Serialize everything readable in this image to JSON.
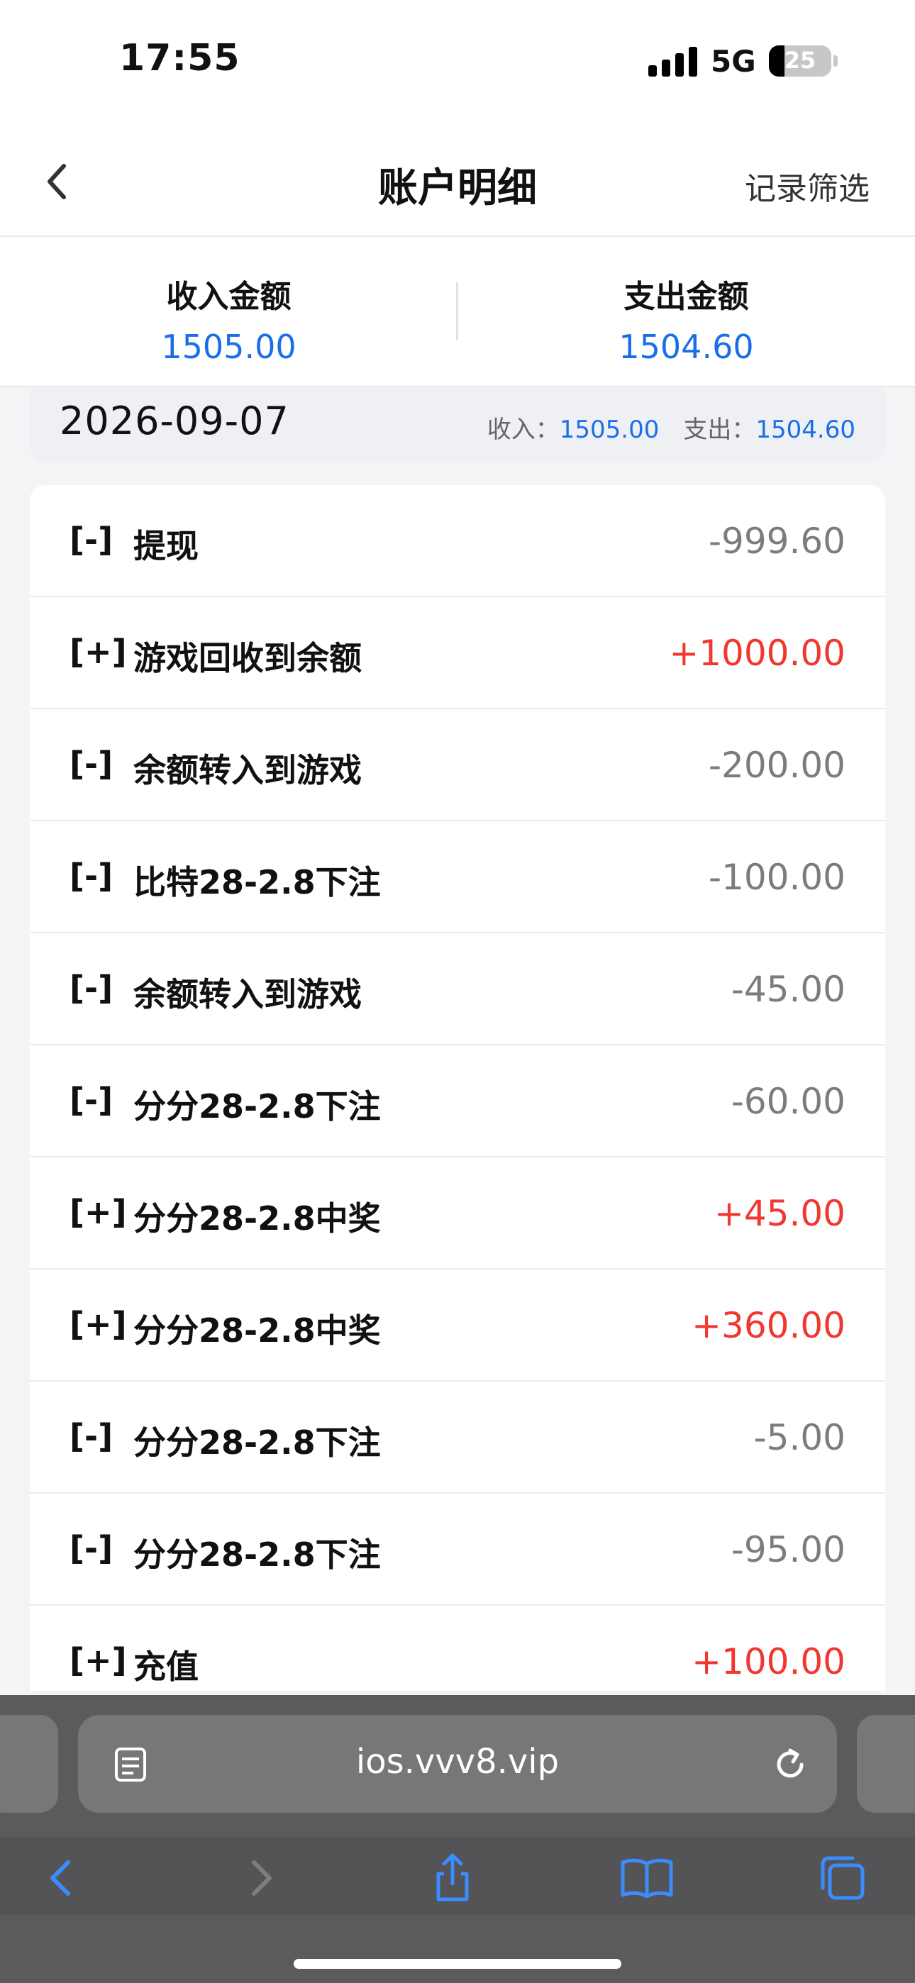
{
  "status": {
    "time": "17:55",
    "network": "5G",
    "battery": "25",
    "battery_level": 0.25
  },
  "nav": {
    "title": "账户明细",
    "filter": "记录筛选"
  },
  "summary": {
    "income_label": "收入金额",
    "income_value": "1505.00",
    "expense_label": "支出金额",
    "expense_value": "1504.60"
  },
  "date_group": {
    "date": "2026-09-07",
    "income_label": "收入：",
    "income": "1505.00",
    "expense_label": "支出：",
    "expense": "1504.60"
  },
  "transactions": [
    {
      "sign": "[-]",
      "desc": "提现",
      "amount": "-999.60"
    },
    {
      "sign": "[+]",
      "desc": "游戏回收到余额",
      "amount": "+1000.00"
    },
    {
      "sign": "[-]",
      "desc": "余额转入到游戏",
      "amount": "-200.00"
    },
    {
      "sign": "[-]",
      "desc": "比特28-2.8下注",
      "amount": "-100.00"
    },
    {
      "sign": "[-]",
      "desc": "余额转入到游戏",
      "amount": "-45.00"
    },
    {
      "sign": "[-]",
      "desc": "分分28-2.8下注",
      "amount": "-60.00"
    },
    {
      "sign": "[+]",
      "desc": "分分28-2.8中奖",
      "amount": "+45.00"
    },
    {
      "sign": "[+]",
      "desc": "分分28-2.8中奖",
      "amount": "+360.00"
    },
    {
      "sign": "[-]",
      "desc": "分分28-2.8下注",
      "amount": "-5.00"
    },
    {
      "sign": "[-]",
      "desc": "分分28-2.8下注",
      "amount": "-95.00"
    },
    {
      "sign": "[+]",
      "desc": "充值",
      "amount": "+100.00"
    }
  ],
  "browser": {
    "url": "ios.vvv8.vip"
  },
  "colors": {
    "income_blue": "#1a6fe8",
    "positive_red": "#f0382f",
    "negative_gray": "#7c7c7c",
    "ios_blue": "#3a8dff"
  },
  "icons": {
    "back": "chevron-left-icon",
    "reader": "reader-mode-icon",
    "reload": "reload-icon",
    "toolbar": [
      "browser-back-icon",
      "browser-forward-icon",
      "share-icon",
      "bookmarks-icon",
      "tabs-icon"
    ]
  }
}
